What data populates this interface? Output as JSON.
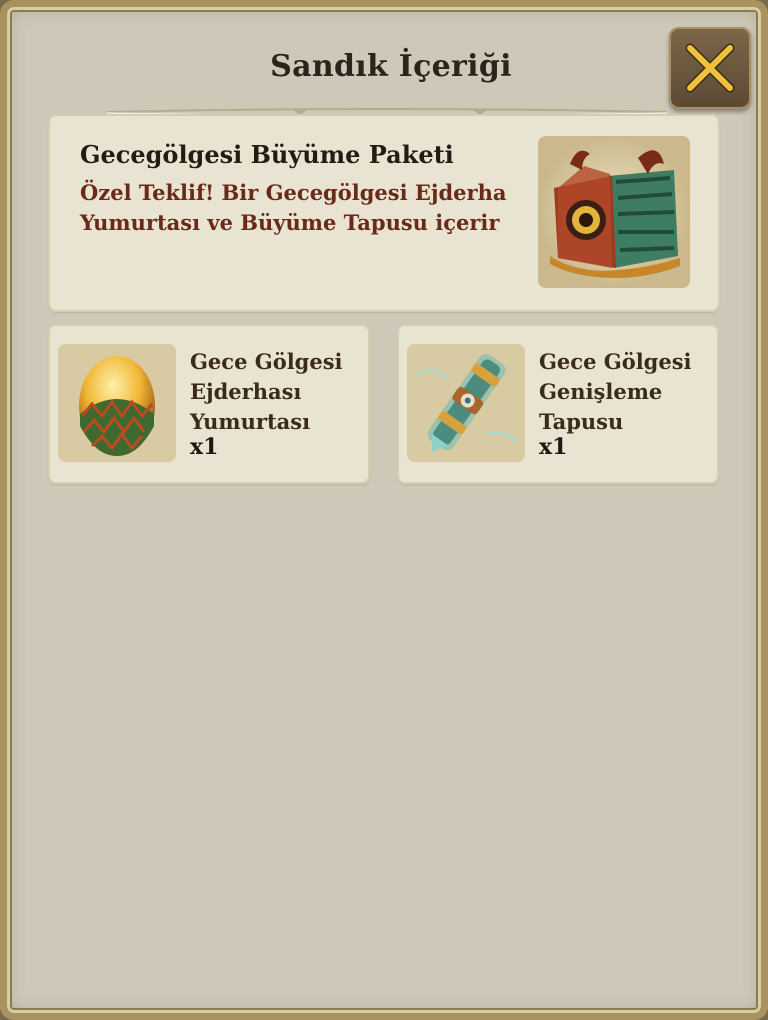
{
  "dialog": {
    "title": "Sandık İçeriği"
  },
  "package": {
    "name": "Gecegölgesi Büyüme Paketi",
    "description": "Özel Teklif! Bir Gecegölgesi Ejderha Yumurtası ve Büyüme Tapusu içerir",
    "icon": "chest-icon"
  },
  "items": [
    {
      "name": "Gece Gölgesi Ejderhası Yumurtası",
      "quantity": "x1",
      "icon": "dragon-egg-icon"
    },
    {
      "name": "Gece Gölgesi Genişleme Tapusu",
      "quantity": "x1",
      "icon": "scroll-icon"
    }
  ],
  "colors": {
    "panel_background": "#cdc8b8",
    "card_background": "#e9e3d1",
    "frame_gold": "#a8935f",
    "description_text": "#6a2a1a",
    "close_x": "#f0c23a"
  }
}
